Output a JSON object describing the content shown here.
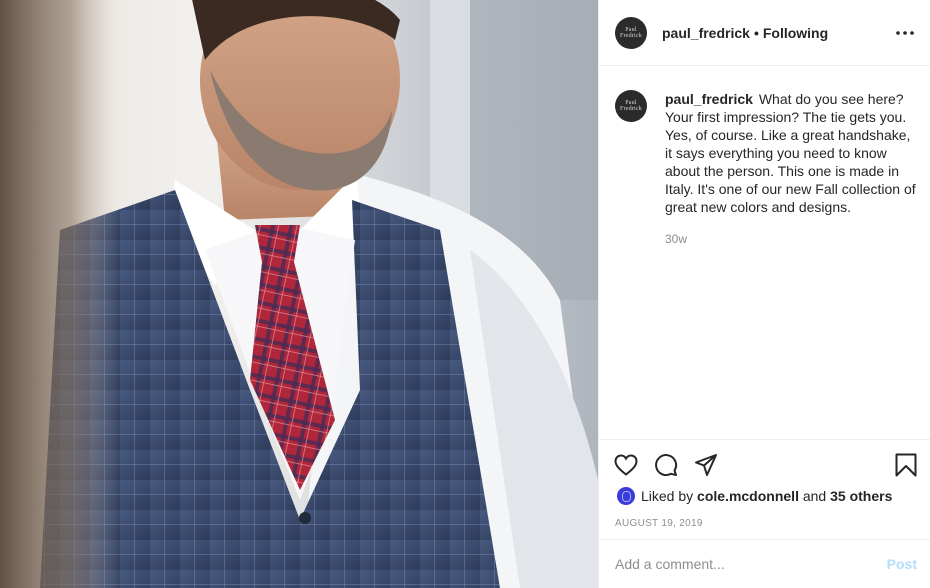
{
  "post": {
    "author": "paul_fredrick",
    "avatar_text": [
      "Paul",
      "Fredrick"
    ],
    "separator": "•",
    "follow_status": "Following",
    "caption": "What do you see here? Your first impression? The tie gets you. Yes, of course. Like a great handshake, it says everything you need to know about the person. This one is made in Italy. It's one of our new Fall collection of great new colors and designs.",
    "time_ago": "30w",
    "likes": {
      "prefix": "Liked by",
      "user": "cole.mcdonnell",
      "and": "and",
      "others": "35 others"
    },
    "date": "AUGUST 19, 2019"
  },
  "icons": {
    "more": "more-options-icon",
    "like": "heart-icon",
    "comment": "comment-icon",
    "share": "share-icon",
    "save": "bookmark-icon"
  },
  "comment_box": {
    "placeholder": "Add a comment...",
    "post_label": "Post"
  },
  "photo": {
    "subject": "man in navy plaid vest, white shirt and red plaid tie"
  },
  "colors": {
    "text": "#262626",
    "muted": "#8e8e8e",
    "divider": "#efefef",
    "post_disabled": "#b2dffc",
    "vest": "#3a4a6e",
    "tie": "#b0263a"
  }
}
